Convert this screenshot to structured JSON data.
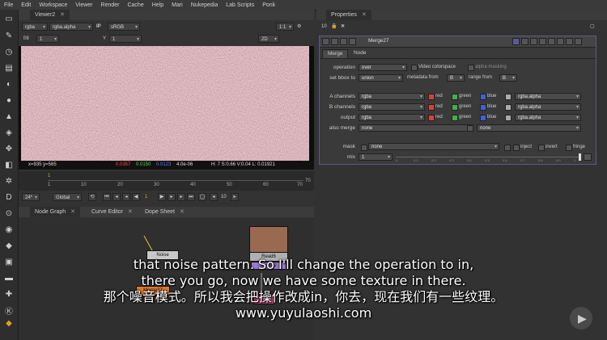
{
  "menubar": [
    "File",
    "Edit",
    "Workspace",
    "Viewer",
    "Render",
    "Cache",
    "Help",
    "Mari",
    "Nukepedia",
    "Lab Scripts",
    "Ponk"
  ],
  "viewer": {
    "tab": "Viewer2",
    "channels": "rgba",
    "alpha": "rgba.alpha",
    "ip": "IP",
    "colorspace": "sRGB",
    "zoom": "1:1",
    "fstop": "f/8",
    "gain_value": "1",
    "y_label": "Y",
    "y_value": "1",
    "view_mode": "2D",
    "info": {
      "coords": "x=935 y=565",
      "r": "0.0357",
      "g": "0.0150",
      "b": "0.0123",
      "a": "4.0e-06",
      "hsvl": "H:  7 S:0.66 V:0.04  L: 0.01921"
    }
  },
  "timeline": {
    "current_frame": "1",
    "ticks": [
      "1",
      "10",
      "20",
      "30",
      "40",
      "50",
      "60",
      "70"
    ],
    "end_frame": "70",
    "fps": "24*",
    "scope": "Global",
    "frame_field": "1",
    "step": "10"
  },
  "graph_tabs": [
    "Node Graph",
    "Curve Editor",
    "Dope Sheet"
  ],
  "nodes": {
    "noise_label": "Noise",
    "read_label": "Read6",
    "read_sub": "formula2",
    "merge_label": "Merge27"
  },
  "properties": {
    "tab": "Properties",
    "count": "10",
    "node_name": "Merge27",
    "subtabs": [
      "Merge",
      "Node"
    ],
    "rows": {
      "operation": {
        "label": "operation",
        "value": "over"
      },
      "video_colorspace": "Video colorspace",
      "alpha_masking": "alpha masking",
      "bbox": {
        "label": "set bbox to",
        "value": "union"
      },
      "metadata": {
        "label": "metadata from",
        "value": "B"
      },
      "range": {
        "label": "range from",
        "value": "B"
      },
      "a_channels": {
        "label": "A channels",
        "value": "rgba",
        "alpha": "rgba.alpha"
      },
      "b_channels": {
        "label": "B channels",
        "value": "rgba",
        "alpha": "rgba.alpha"
      },
      "output": {
        "label": "output",
        "value": "rgba",
        "alpha": "rgba.alpha"
      },
      "also_merge": {
        "label": "also merge",
        "value": "none",
        "value2": "none"
      },
      "mask": {
        "label": "mask",
        "value": "none",
        "inject": "inject",
        "invert": "invert",
        "fringe": "fringe"
      },
      "mix": {
        "label": "mix",
        "value": "1"
      }
    },
    "channel_labels": {
      "red": "red",
      "green": "green",
      "blue": "blue"
    },
    "mix_ticks": [
      "0",
      "0.1",
      "0.2",
      "0.3",
      "0.4",
      "0.5",
      "0.6",
      "0.7",
      "0.8",
      "0.9",
      "1"
    ]
  },
  "subtitles": {
    "line1": "that noise pattern. So I'll change the operation to in,",
    "line2": "there you go, now we have some texture in there.",
    "line3": "那个噪音模式。所以我会把操作改成in，你去，现在我们有一些纹理。",
    "line4": "www.yuyulaoshi.com"
  }
}
